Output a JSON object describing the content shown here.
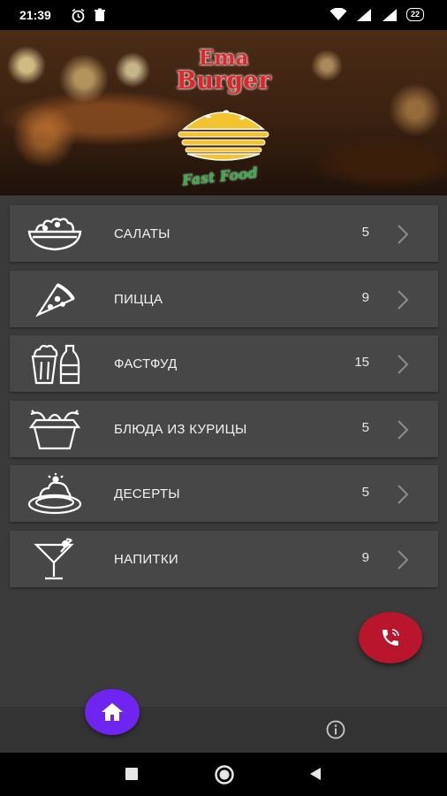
{
  "status_bar": {
    "time": "21:39",
    "battery": "22"
  },
  "banner": {
    "logo_line1": "Ema",
    "logo_line2": "Burger",
    "logo_line3": "Fast Food"
  },
  "menu": {
    "items": [
      {
        "label": "САЛАТЫ",
        "count": "5",
        "icon": "salad-bowl-icon"
      },
      {
        "label": "ПИЦЦА",
        "count": "9",
        "icon": "pizza-slice-icon"
      },
      {
        "label": "ФАСТФУД",
        "count": "15",
        "icon": "fastfood-icon"
      },
      {
        "label": "БЛЮДА ИЗ КУРИЦЫ",
        "count": "5",
        "icon": "chicken-box-icon"
      },
      {
        "label": "ДЕСЕРТЫ",
        "count": "5",
        "icon": "dessert-icon"
      },
      {
        "label": "НАПИТКИ",
        "count": "9",
        "icon": "cocktail-icon"
      }
    ]
  },
  "colors": {
    "background": "#3b3b3b",
    "card": "#474747",
    "call_button": "#b9162e",
    "home_button": "#6f25f0"
  }
}
